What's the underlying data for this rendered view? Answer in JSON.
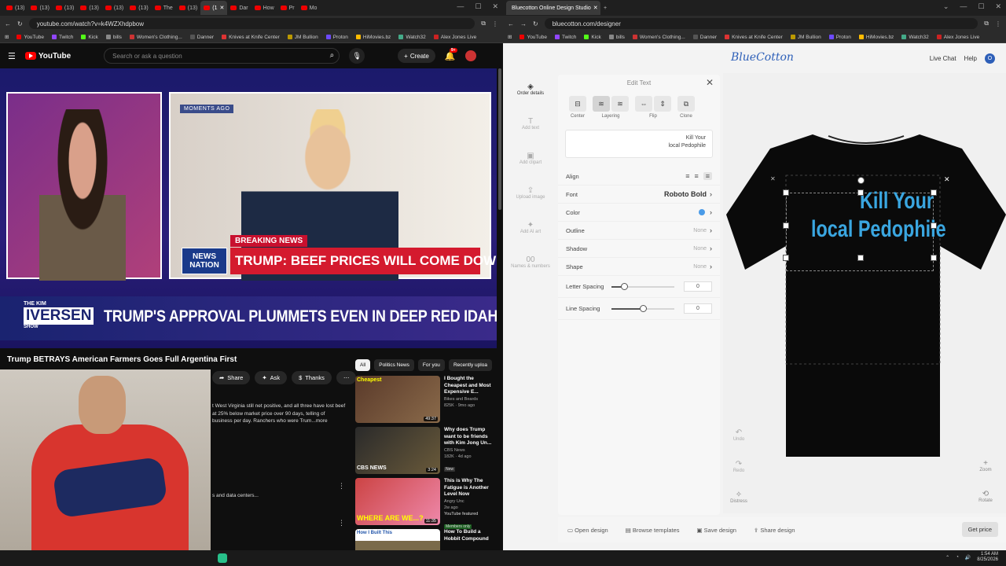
{
  "left_browser": {
    "tabs": [
      "(13)",
      "(13)",
      "(13)",
      "(13)",
      "(13)",
      "(13)",
      "The",
      "(13)",
      "(1",
      "Dar",
      "How",
      "Pr",
      "Mo"
    ],
    "url": "youtube.com/watch?v=k4WZXhdpbow",
    "bookmarks": [
      "YouTube",
      "Twitch",
      "Kick",
      "bills",
      "Women's Clothing...",
      "Danner",
      "Knives at Knife Center",
      "JM Bullion",
      "Proton",
      "HiMovies.bz",
      "Watch32",
      "Alex Jones Live"
    ]
  },
  "youtube": {
    "logo": "YouTube",
    "search_placeholder": "Search or ask a question",
    "create_label": "Create",
    "notif_count": "9+",
    "video": {
      "moments_tag": "MOMENTS AGO",
      "breaking": "BREAKING NEWS",
      "network_line1": "NEWS",
      "network_line2": "NATION",
      "headline": "TRUMP: BEEF PRICES WILL COME DOWN",
      "show_the": "THE KIM",
      "show_name": "IVERSEN",
      "show_suffix": "SHOW",
      "banner": "TRUMP'S APPROVAL PLUMMETS EVEN IN DEEP RED IDAHO"
    },
    "title": "Trump BETRAYS American Farmers Goes Full Argentina First",
    "actions": [
      "Share",
      "Ask",
      "Thanks"
    ],
    "description": "t West Virginia still net positive, and all three have lost beef at 25% below market price over 90 days, telling of business per day. Ranchers who were Trum",
    "description_more": "...more",
    "description2": "s and data centers...",
    "chips": [
      "All",
      "Politics News",
      "For you",
      "Recently uploa"
    ],
    "recs": [
      {
        "title": "I Bought the Cheapest and Most Expensive E...",
        "channel": "Bikes and Beards",
        "meta": "825K · 9mo ago",
        "duration": "49:37",
        "thumb_text": "Cheapest",
        "badge": ""
      },
      {
        "title": "Why does Trump want to be friends with Kim Jong Un...",
        "channel": "CBS News",
        "meta": "182K · 4d ago",
        "duration": "3:24",
        "thumb_text": "CBS NEWS",
        "badge": "New"
      },
      {
        "title": "This is Why The Fatigue is Another Level Now",
        "channel": "Angry Unc",
        "meta": "2w ago",
        "duration": "11:35",
        "thumb_text": "WHERE ARE WE...?",
        "badge": "YouTube featured",
        "badge2": "Members only"
      },
      {
        "title": "How To Build a Hobbit Compound",
        "channel": "",
        "meta": "",
        "duration": "",
        "thumb_text": "How I Built This",
        "badge": ""
      }
    ]
  },
  "right_browser": {
    "tab_title": "Bluecotton Online Design Studio",
    "url": "bluecotton.com/designer",
    "bookmarks": [
      "YouTube",
      "Twitch",
      "Kick",
      "bills",
      "Women's Clothing...",
      "Danner",
      "Knives at Knife Center",
      "JM Bullion",
      "Proton",
      "HiMovies.bz",
      "Watch32",
      "Alex Jones Live"
    ]
  },
  "bluecotton": {
    "logo": "BlueCotton",
    "live_chat": "Live Chat",
    "help": "Help",
    "avatar": "O",
    "sidebar": [
      {
        "label": "Order details",
        "icon": "◈"
      },
      {
        "label": "Add text",
        "icon": "T"
      },
      {
        "label": "Add clipart",
        "icon": "▣"
      },
      {
        "label": "Upload image",
        "icon": "⇪"
      },
      {
        "label": "Add AI art",
        "icon": "✦"
      },
      {
        "label": "Names & numbers",
        "icon": "00"
      }
    ],
    "panel": {
      "title": "Edit Text",
      "tools": [
        "Center",
        "Layering",
        "Flip",
        "Clone"
      ],
      "text_line1": "Kill Your",
      "text_line2": "local Pedophile",
      "align_label": "Align",
      "font_label": "Font",
      "font_value": "Roboto Bold",
      "color_label": "Color",
      "color_value": "#4a9be8",
      "outline_label": "Outline",
      "outline_value": "None",
      "shadow_label": "Shadow",
      "shadow_value": "None",
      "shape_label": "Shape",
      "shape_value": "None",
      "letter_spacing_label": "Letter Spacing",
      "letter_spacing_value": "0",
      "letter_spacing_slider": 0.2,
      "line_spacing_label": "Line Spacing",
      "line_spacing_value": "0",
      "line_spacing_slider": 0.5
    },
    "design_line1": "Kill Your",
    "design_line2": "local Pedophile",
    "canvas_tools": [
      "Undo",
      "Redo",
      "Distress",
      "Zoom",
      "Rotate"
    ],
    "bottom": [
      "Open design",
      "Browse templates",
      "Save design",
      "Share design"
    ],
    "get_price": "Get price"
  },
  "taskbar": {
    "time": "1:54 AM",
    "date": "8/25/2026"
  }
}
